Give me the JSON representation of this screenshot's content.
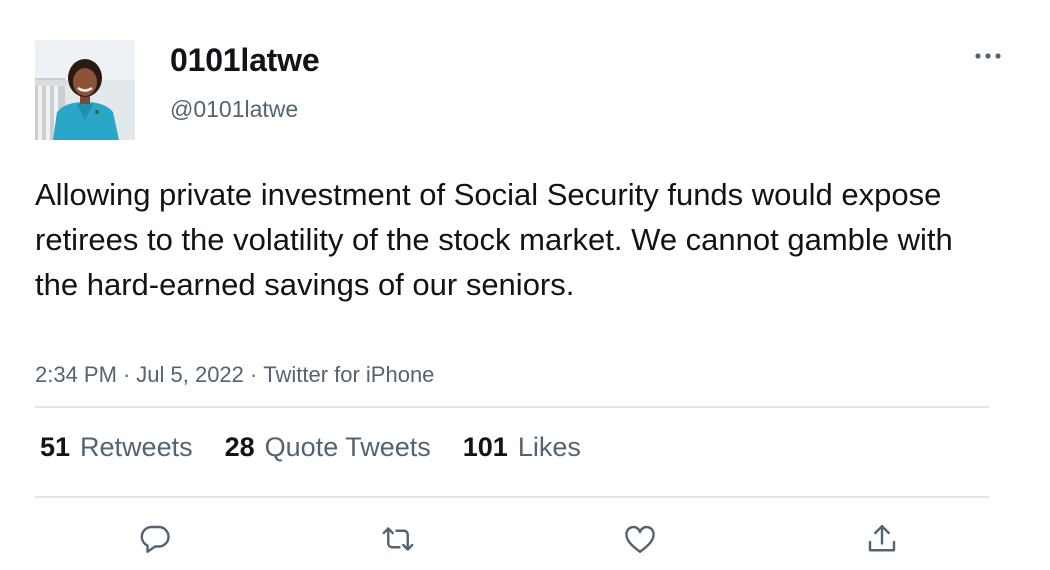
{
  "user": {
    "display_name": "0101latwe",
    "handle": "@0101latwe"
  },
  "tweet": {
    "text": "Allowing private investment of Social Security funds would expose retirees to the volatility of the stock market. We cannot gamble with the hard-earned savings of our seniors.",
    "time": "2:34 PM",
    "date": "Jul 5, 2022",
    "source": "Twitter for iPhone",
    "separator": "·"
  },
  "stats": {
    "retweets_count": "51",
    "retweets_label": "Retweets",
    "quotes_count": "28",
    "quotes_label": "Quote Tweets",
    "likes_count": "101",
    "likes_label": "Likes"
  },
  "icons": {
    "more": "more-horizontal-icon",
    "reply": "reply-icon",
    "retweet": "retweet-icon",
    "like": "heart-icon",
    "share": "share-icon"
  },
  "colors": {
    "text_primary": "#0f1419",
    "text_secondary": "#536471",
    "divider": "#e1e5e8"
  }
}
